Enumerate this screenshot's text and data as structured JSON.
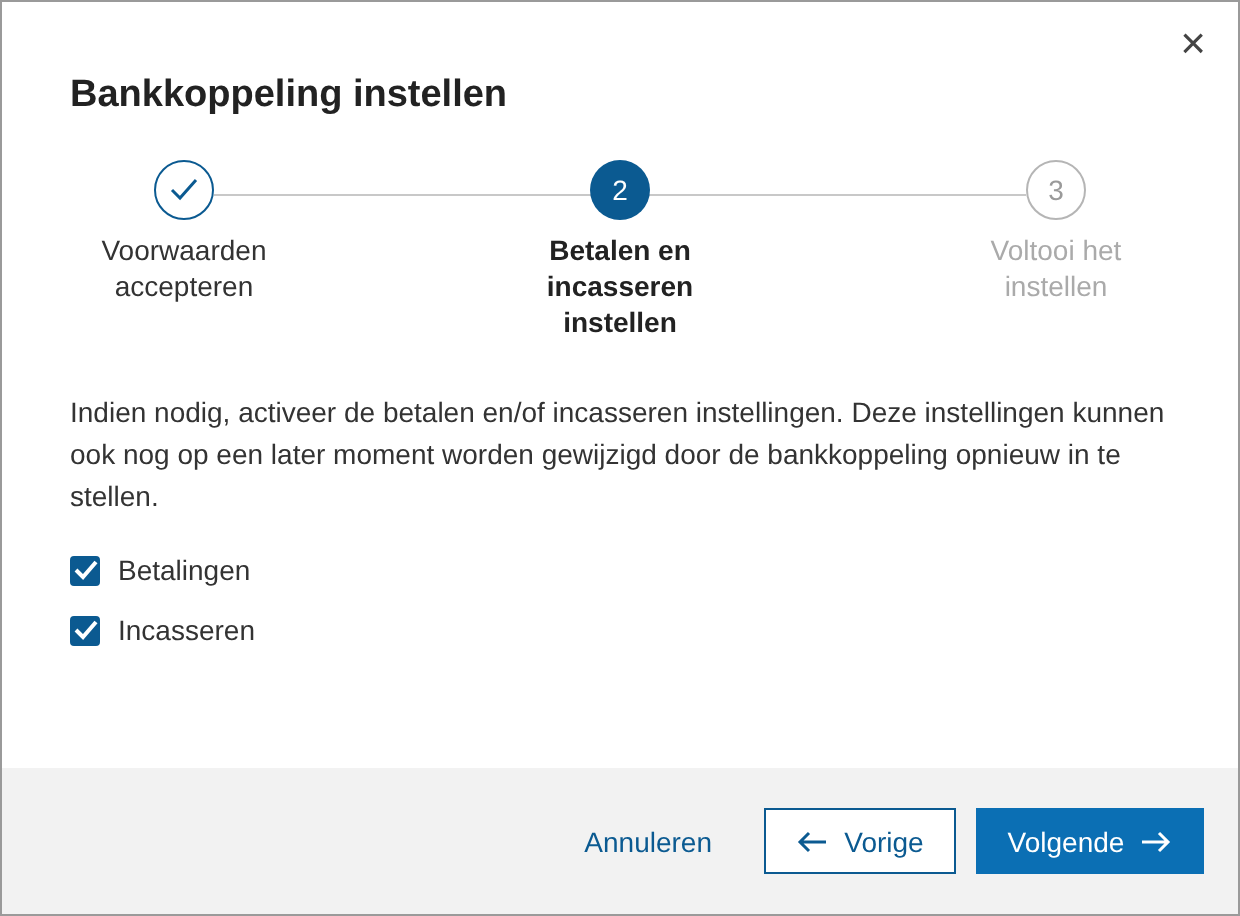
{
  "dialog": {
    "title": "Bankkoppeling instellen",
    "close": "×"
  },
  "steps": [
    {
      "label": "Voorwaarden accepteren",
      "kind": "done"
    },
    {
      "label": "Betalen en incasseren instellen",
      "number": "2",
      "kind": "current"
    },
    {
      "label": "Voltooi het instellen",
      "number": "3",
      "kind": "upcoming"
    }
  ],
  "description": "Indien nodig, activeer de betalen en/of incasseren instellingen. Deze instellingen kunnen ook nog op een later moment worden gewijzigd door de bankkoppeling opnieuw in te stellen.",
  "options": [
    {
      "label": "Betalingen",
      "checked": true
    },
    {
      "label": "Incasseren",
      "checked": true
    }
  ],
  "footer": {
    "cancel": "Annuleren",
    "back": "Vorige",
    "next": "Volgende"
  }
}
